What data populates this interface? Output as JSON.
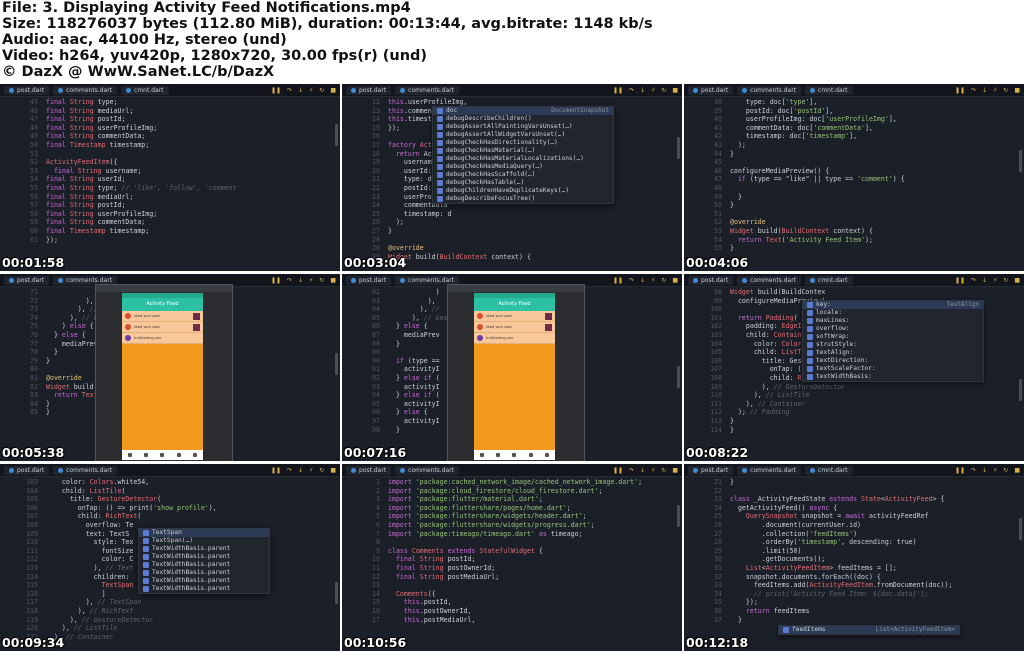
{
  "header": {
    "line1": "File: 3. Displaying Activity Feed Notifications.mp4",
    "line2": "Size: 118276037 bytes (112.80 MiB), duration: 00:13:44, avg.bitrate: 1148 kb/s",
    "line3": "Audio: aac, 44100 Hz, stereo (und)",
    "line4": "Video: h264, yuv420p, 1280x720, 30.00 fps(r) (und)",
    "line5": "© DazX @ WwW.SaNet.LC/b/DazX"
  },
  "thumbnails": [
    {
      "timestamp": "00:01:58",
      "tabs": [
        "post.dart",
        "comments.dart",
        "cmnt.dart"
      ],
      "lines": [
        {
          "n": "",
          "t": "final String type;"
        },
        {
          "n": "",
          "t": "final String mediaUrl;"
        },
        {
          "n": "",
          "t": "final String postId;"
        },
        {
          "n": "",
          "t": "final String userProfileImg;"
        },
        {
          "n": "",
          "t": "final String commentData;"
        },
        {
          "n": "",
          "t": "final Timestamp timestamp;"
        },
        {
          "n": "",
          "t": ""
        },
        {
          "n": "",
          "t": "ActivityFeedItem({"
        },
        {
          "n": "",
          "t": "  final String username;"
        },
        {
          "n": "",
          "t": "final String userId;"
        },
        {
          "n": "",
          "t": "final String type; // 'like', 'follow', 'comment'"
        },
        {
          "n": "",
          "t": "final String mediaUrl;"
        },
        {
          "n": "",
          "t": "final String postId;"
        },
        {
          "n": "",
          "t": "final String userProfileImg;"
        },
        {
          "n": "",
          "t": "final String commentData;"
        },
        {
          "n": "",
          "t": "final Timestamp timestamp;"
        },
        {
          "n": "",
          "t": "});"
        }
      ]
    },
    {
      "timestamp": "00:03:04",
      "tabs": [
        "post.dart",
        "comments.dart"
      ],
      "lines": [
        {
          "n": "",
          "t": "this.userProfileImg,"
        },
        {
          "n": "",
          "t": "this.commentData,"
        },
        {
          "n": "",
          "t": "this.timestamp,"
        },
        {
          "n": "",
          "t": "});"
        },
        {
          "n": "",
          "t": ""
        },
        {
          "n": "",
          "t": "factory ActivityFeedItem"
        },
        {
          "n": "",
          "t": "  return Activit"
        },
        {
          "n": "",
          "t": "    username: do"
        },
        {
          "n": "",
          "t": "    userId: doc["
        },
        {
          "n": "",
          "t": "    type: doc['t"
        },
        {
          "n": "",
          "t": "    postId: doc["
        },
        {
          "n": "",
          "t": "    userProfileI"
        },
        {
          "n": "",
          "t": "    commentData"
        },
        {
          "n": "",
          "t": "    timestamp: d"
        },
        {
          "n": "",
          "t": "  );"
        },
        {
          "n": "",
          "t": "}"
        },
        {
          "n": "",
          "t": ""
        },
        {
          "n": "",
          "t": "@override"
        },
        {
          "n": "",
          "t": "Widget build(BuildContext context) {"
        }
      ],
      "popup": {
        "hint": "DocumentSnapshot",
        "items": [
          "doc",
          "debugDescribeChildren()",
          "debugAssertAllPaintingVarsUnset(…)",
          "debugAssertAllWidgetVarsUnset(…)",
          "debugCheckHasDirectionality(…)",
          "debugCheckHasMaterial(…)",
          "debugCheckHasMaterialLocalizations(…)",
          "debugCheckHasMediaQuery(…)",
          "debugCheckHasScaffold(…)",
          "debugCheckHasTable(…)",
          "debugChildrenHaveDuplicateKeys(…)",
          "debugDescribeFocusTree()"
        ]
      }
    },
    {
      "timestamp": "00:04:06",
      "tabs": [
        "post.dart",
        "comments.dart",
        "cmnt.dart"
      ],
      "lines": [
        {
          "n": "",
          "t": "    type: doc['type'],"
        },
        {
          "n": "",
          "t": "    postId: doc['postId'],"
        },
        {
          "n": "",
          "t": "    userProfileImg: doc['userProfileImg'],"
        },
        {
          "n": "",
          "t": "    commentData: doc['commentData'],"
        },
        {
          "n": "",
          "t": "    timestamp: doc['timestamp'],"
        },
        {
          "n": "",
          "t": "  );"
        },
        {
          "n": "",
          "t": "}"
        },
        {
          "n": "",
          "t": ""
        },
        {
          "n": "",
          "t": "configureMediaPreview() {"
        },
        {
          "n": "",
          "t": "  if (type == \"like\" || type == 'comment') {"
        },
        {
          "n": "",
          "t": ""
        },
        {
          "n": "",
          "t": "  }"
        },
        {
          "n": "",
          "t": "}"
        },
        {
          "n": "",
          "t": ""
        },
        {
          "n": "",
          "t": "@override"
        },
        {
          "n": "",
          "t": "Widget build(BuildContext context) {"
        },
        {
          "n": "",
          "t": "  return Text('Activity Feed Item');"
        },
        {
          "n": "",
          "t": "}"
        }
      ]
    },
    {
      "timestamp": "00:05:38",
      "tabs": [
        "post.dart",
        "comments.dart"
      ],
      "lines": [
        {
          "n": "",
          "t": "            )"
        },
        {
          "n": "",
          "t": "          ),"
        },
        {
          "n": "",
          "t": "        ), //"
        },
        {
          "n": "",
          "t": "      ), // Gest"
        },
        {
          "n": "",
          "t": "    ) else {"
        },
        {
          "n": "",
          "t": "  } else {"
        },
        {
          "n": "",
          "t": "    mediaPrev"
        },
        {
          "n": "",
          "t": "  }"
        },
        {
          "n": "",
          "t": "}"
        },
        {
          "n": "",
          "t": ""
        },
        {
          "n": "",
          "t": "@override"
        },
        {
          "n": "",
          "t": "Widget build("
        },
        {
          "n": "",
          "t": "  return Text"
        },
        {
          "n": "",
          "t": "}"
        },
        {
          "n": "",
          "t": "}"
        }
      ],
      "app": {
        "title": "Activity Feed",
        "items": [
          "liked your post",
          "liked your post",
          "is following you"
        ]
      }
    },
    {
      "timestamp": "00:07:16",
      "tabs": [
        "post.dart",
        "comments.dart"
      ],
      "lines": [
        {
          "n": "",
          "t": "            )"
        },
        {
          "n": "",
          "t": "          ),"
        },
        {
          "n": "",
          "t": "        ), //"
        },
        {
          "n": "",
          "t": "      ), // Ges"
        },
        {
          "n": "",
          "t": "  } else {"
        },
        {
          "n": "",
          "t": "    mediaPrev"
        },
        {
          "n": "",
          "t": "  }"
        },
        {
          "n": "",
          "t": ""
        },
        {
          "n": "",
          "t": "  if (type =="
        },
        {
          "n": "",
          "t": "    activityI"
        },
        {
          "n": "",
          "t": "  } else if ("
        },
        {
          "n": "",
          "t": "    activityI"
        },
        {
          "n": "",
          "t": "  } else if ("
        },
        {
          "n": "",
          "t": "    activityI"
        },
        {
          "n": "",
          "t": "  } else {"
        },
        {
          "n": "",
          "t": "    activityI                  \";"
        },
        {
          "n": "",
          "t": "  }"
        }
      ],
      "app": {
        "title": "Activity Feed",
        "items": [
          "liked your post",
          "liked your post",
          "is following you"
        ]
      }
    },
    {
      "timestamp": "00:08:22",
      "tabs": [
        "post.dart",
        "comments.dart",
        "cmnt.dart"
      ],
      "lines": [
        {
          "n": "",
          "t": "Widget build(BuildContex"
        },
        {
          "n": "",
          "t": "  configureMediaPreview("
        },
        {
          "n": "",
          "t": ""
        },
        {
          "n": "",
          "t": "  return Padding("
        },
        {
          "n": "",
          "t": "    padding: EdgeInsets"
        },
        {
          "n": "",
          "t": "    child: Container("
        },
        {
          "n": "",
          "t": "      color: Colors.whit"
        },
        {
          "n": "",
          "t": "      child: ListTile("
        },
        {
          "n": "",
          "t": "        title: GestureDe"
        },
        {
          "n": "",
          "t": "          onTap: () => pr"
        },
        {
          "n": "",
          "t": "          child: RichText("
        },
        {
          "n": "",
          "t": "        ), // GestureDetector"
        },
        {
          "n": "",
          "t": "      ), // ListTile"
        },
        {
          "n": "",
          "t": "    ), // Container"
        },
        {
          "n": "",
          "t": "  ); // Padding"
        },
        {
          "n": "",
          "t": "}"
        },
        {
          "n": "",
          "t": "}"
        }
      ],
      "popup": {
        "hint": "TextAlign",
        "items": [
          "key:",
          "locale:",
          "maxLines:",
          "overflow:",
          "softWrap:",
          "strutStyle:",
          "textAlign:",
          "textDirection:",
          "textScaleFactor:",
          "textWidthBasis:"
        ]
      }
    },
    {
      "timestamp": "00:09:34",
      "tabs": [
        "post.dart",
        "comments.dart"
      ],
      "lines": [
        {
          "n": "",
          "t": "    color: Colors.white54,"
        },
        {
          "n": "",
          "t": "    child: ListTile("
        },
        {
          "n": "",
          "t": "      title: GestureDetector("
        },
        {
          "n": "",
          "t": "        onTap: () => print('show profile'),"
        },
        {
          "n": "",
          "t": "        child: RichText("
        },
        {
          "n": "",
          "t": "          overflow: Te"
        },
        {
          "n": "",
          "t": "          text: TextS"
        },
        {
          "n": "",
          "t": "            style: Tex"
        },
        {
          "n": "",
          "t": "              fontSize"
        },
        {
          "n": "",
          "t": "              color: C"
        },
        {
          "n": "",
          "t": "            ), // Text"
        },
        {
          "n": "",
          "t": "            children:"
        },
        {
          "n": "",
          "t": "              TextSpan"
        },
        {
          "n": "",
          "t": "              ]"
        },
        {
          "n": "",
          "t": "          ), // TextSpan"
        },
        {
          "n": "",
          "t": "        ), // RichText"
        },
        {
          "n": "",
          "t": "      ), // GestureDetector"
        },
        {
          "n": "",
          "t": "    ), // ListTile"
        },
        {
          "n": "",
          "t": "  ), // Container"
        }
      ],
      "popup": {
        "hint": "",
        "items": [
          "TextSpan",
          "TextSpan(…)",
          "TextWidthBasis.parent",
          "TextWidthBasis.parent",
          "TextWidthBasis.parent",
          "TextWidthBasis.parent",
          "TextWidthBasis.parent",
          "TextWidthBasis.parent"
        ]
      }
    },
    {
      "timestamp": "00:10:56",
      "tabs": [
        "post.dart",
        "comments.dart"
      ],
      "lines": [
        {
          "n": "",
          "t": "import 'package:cached_network_image/cached_network_image.dart';"
        },
        {
          "n": "",
          "t": "import 'package:cloud_firestore/cloud_firestore.dart';"
        },
        {
          "n": "",
          "t": "import 'package:flutter/material.dart';"
        },
        {
          "n": "",
          "t": "import 'package:fluttershare/pages/home.dart';"
        },
        {
          "n": "",
          "t": "import 'package:fluttershare/widgets/header.dart';"
        },
        {
          "n": "",
          "t": "import 'package:fluttershare/widgets/progress.dart';"
        },
        {
          "n": "",
          "t": "import 'package:timeago/timeago.dart' as timeago;"
        },
        {
          "n": "",
          "t": ""
        },
        {
          "n": "",
          "t": "class Comments extends StatefulWidget {"
        },
        {
          "n": "",
          "t": "  final String postId;"
        },
        {
          "n": "",
          "t": "  final String postOwnerId;"
        },
        {
          "n": "",
          "t": "  final String postMediaUrl;"
        },
        {
          "n": "",
          "t": ""
        },
        {
          "n": "",
          "t": "  Comments({"
        },
        {
          "n": "",
          "t": "    this.postId,"
        },
        {
          "n": "",
          "t": "    this.postOwnerId,"
        },
        {
          "n": "",
          "t": "    this.postMediaUrl,"
        }
      ]
    },
    {
      "timestamp": "00:12:18",
      "tabs": [
        "post.dart",
        "comments.dart",
        "cmnt.dart"
      ],
      "lines": [
        {
          "n": "",
          "t": "}"
        },
        {
          "n": "",
          "t": ""
        },
        {
          "n": "",
          "t": "class _ActivityFeedState extends State<ActivityFeed> {"
        },
        {
          "n": "",
          "t": "  getActivityFeed() async {"
        },
        {
          "n": "",
          "t": "    QuerySnapshot snapshot = await activityFeedRef"
        },
        {
          "n": "",
          "t": "        .document(currentUser.id)"
        },
        {
          "n": "",
          "t": "        .collection('feedItems')"
        },
        {
          "n": "",
          "t": "        .orderBy('timestamp', descending: true)"
        },
        {
          "n": "",
          "t": "        .limit(50)"
        },
        {
          "n": "",
          "t": "        .getDocuments();"
        },
        {
          "n": "",
          "t": "    List<ActivityFeedItem> feedItems = [];"
        },
        {
          "n": "",
          "t": "    snapshot.documents.forEach((doc) {"
        },
        {
          "n": "",
          "t": "      feedItems.add(ActivityFeedItem.fromDocument(doc));"
        },
        {
          "n": "",
          "t": "      // print('Activity Feed Item: ${doc.data}');"
        },
        {
          "n": "",
          "t": "    });"
        },
        {
          "n": "",
          "t": "    return feedItems"
        },
        {
          "n": "",
          "t": "  }"
        }
      ],
      "popup": {
        "hint": "List<ActivityFeedItem>",
        "items": [
          "feedItems"
        ]
      }
    }
  ]
}
